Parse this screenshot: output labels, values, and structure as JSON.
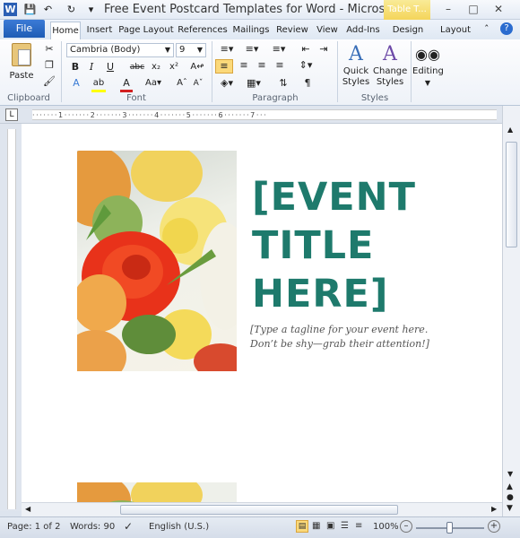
{
  "app": {
    "title": "Free Event Postcard Templates for Word - Microsof...",
    "context_tab": "Table T..."
  },
  "tabs": [
    "Home",
    "Insert",
    "Page Layout",
    "References",
    "Mailings",
    "Review",
    "View",
    "Add-Ins",
    "Design",
    "Layout"
  ],
  "file_tab": "File",
  "clipboard": {
    "paste": "Paste",
    "group": "Clipboard"
  },
  "font": {
    "name": "Cambria (Body)",
    "size": "9",
    "group": "Font"
  },
  "paragraph": {
    "group": "Paragraph"
  },
  "styles": {
    "quick": "Quick",
    "quick2": "Styles",
    "change": "Change",
    "change2": "Styles",
    "group": "Styles"
  },
  "editing": {
    "label": "Editing"
  },
  "document": {
    "title_lines": [
      "[EVENT",
      "TITLE",
      "HERE]"
    ],
    "tagline": "[Type a tagline for your event here. Don’t be shy—grab their attention!]"
  },
  "status": {
    "page": "Page: 1 of 2",
    "words": "Words: 90",
    "language": "English (U.S.)",
    "zoom": "100%"
  },
  "colors": {
    "accent": "#1e7a6c",
    "file_tab": "#2563be"
  }
}
